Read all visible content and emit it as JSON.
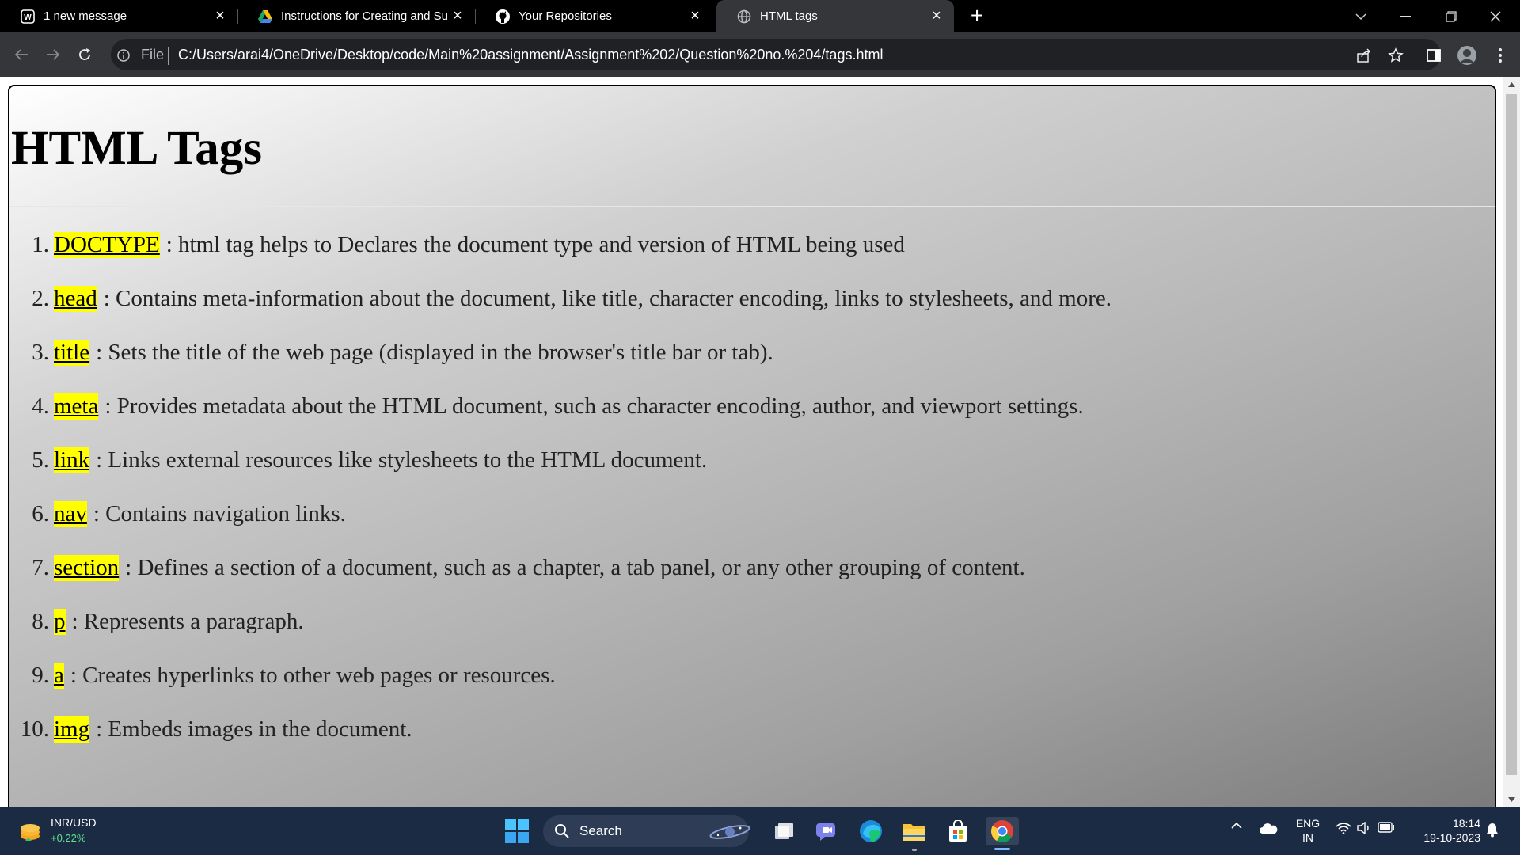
{
  "tabs": [
    {
      "title": "1 new message",
      "icon": "wordpress-icon"
    },
    {
      "title": "Instructions for Creating and Sub",
      "icon": "google-drive-icon"
    },
    {
      "title": "Your Repositories",
      "icon": "github-icon"
    },
    {
      "title": "HTML tags",
      "icon": "globe-icon",
      "active": true
    }
  ],
  "address_bar": {
    "scheme_label": "File",
    "url": "C:/Users/arai4/OneDrive/Desktop/code/Main%20assignment/Assignment%202/Question%20no.%204/tags.html"
  },
  "page": {
    "title": "HTML Tags",
    "items": [
      {
        "num": "1.",
        "tag": "DOCTYPE",
        "desc": ": html tag helps to Declares the document type and version of HTML being used"
      },
      {
        "num": "2.",
        "tag": "head",
        "desc": ": Contains meta-information about the document, like title, character encoding, links to stylesheets, and more."
      },
      {
        "num": "3.",
        "tag": "title",
        "desc": ": Sets the title of the web page (displayed in the browser's title bar or tab)."
      },
      {
        "num": "4.",
        "tag": "meta",
        "desc": ": Provides metadata about the HTML document, such as character encoding, author, and viewport settings."
      },
      {
        "num": "5.",
        "tag": "link",
        "desc": ": Links external resources like stylesheets to the HTML document."
      },
      {
        "num": "6.",
        "tag": "nav",
        "desc": ": Contains navigation links."
      },
      {
        "num": "7.",
        "tag": "section",
        "desc": ": Defines a section of a document, such as a chapter, a tab panel, or any other grouping of content."
      },
      {
        "num": "8.",
        "tag": "p",
        "desc": ": Represents a paragraph."
      },
      {
        "num": "9.",
        "tag": "a",
        "desc": ": Creates hyperlinks to other web pages or resources."
      },
      {
        "num": "10.",
        "tag": "img",
        "desc": ": Embeds images in the document."
      }
    ],
    "highlight_color": "#ffff00"
  },
  "taskbar": {
    "widget": {
      "title": "INR/USD",
      "value": "+0.22%"
    },
    "search_label": "Search",
    "apps": [
      "task-view-icon",
      "teams-chat-icon",
      "edge-icon",
      "file-explorer-icon",
      "microsoft-store-icon",
      "chrome-icon"
    ],
    "tray": {
      "lang_line1": "ENG",
      "lang_line2": "IN",
      "time": "18:14",
      "date": "19-10-2023"
    }
  },
  "colors": {
    "tabstrip_bg": "#000000",
    "toolbar_bg": "#35363a",
    "taskbar_bg": "#1c2b44",
    "accent": "#7ab8ff"
  }
}
